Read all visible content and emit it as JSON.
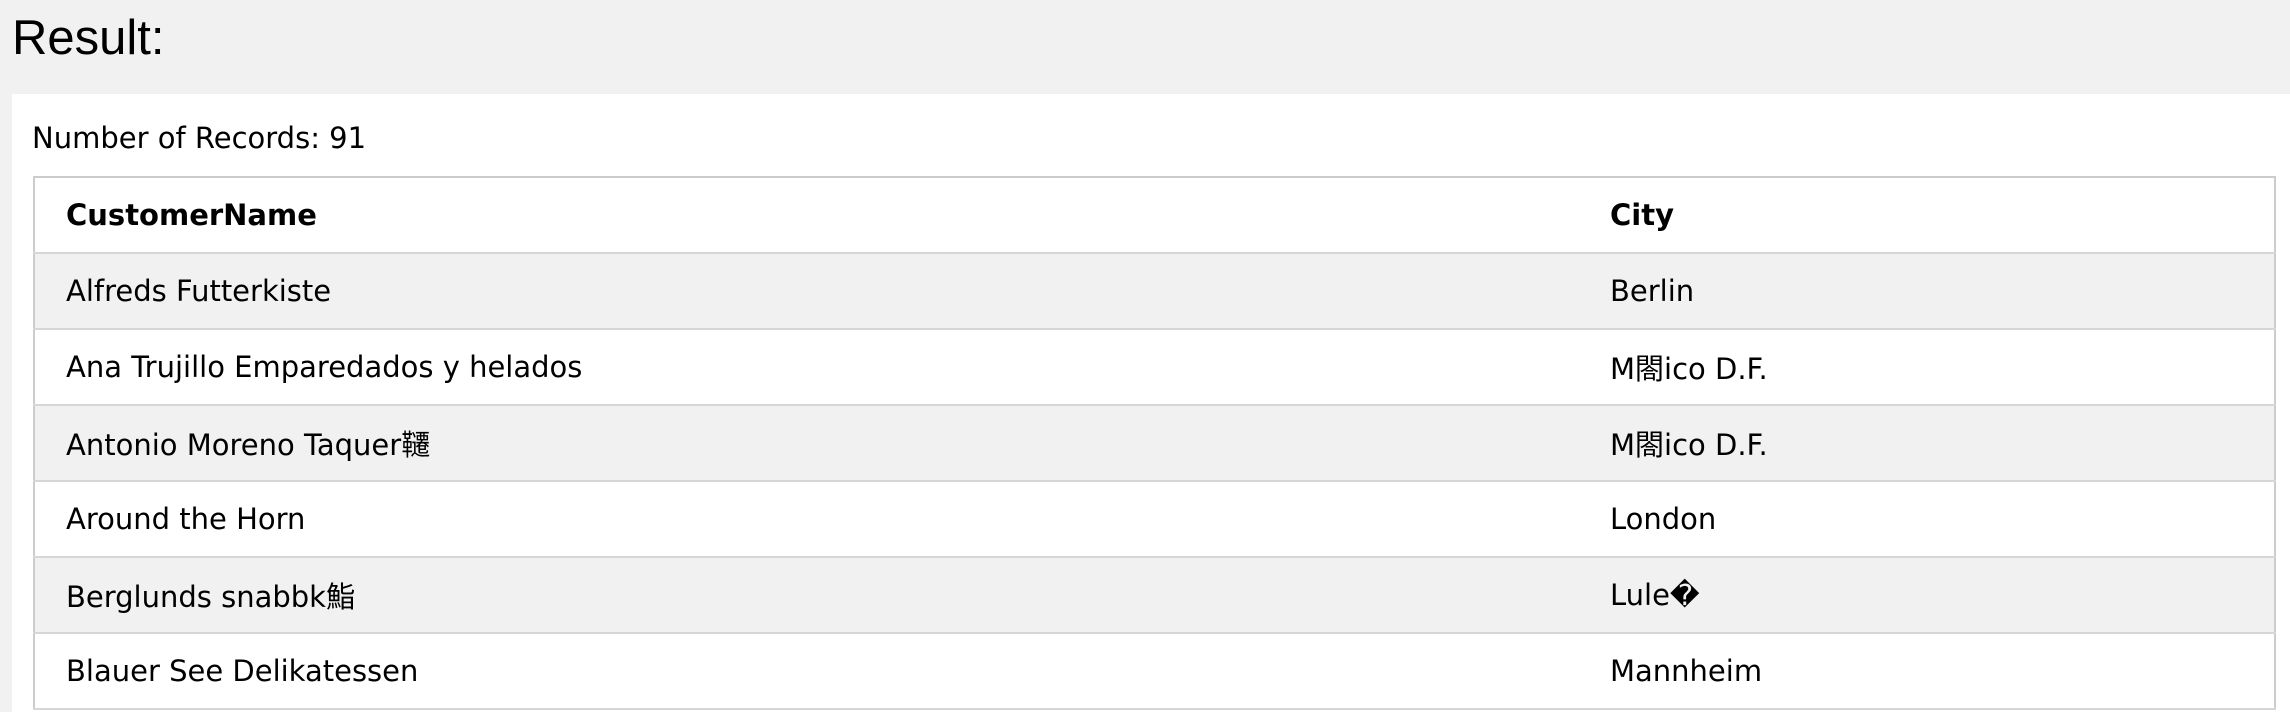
{
  "heading": "Result:",
  "record_count_text": "Number of Records: 91",
  "table": {
    "columns": [
      "CustomerName",
      "City"
    ],
    "rows": [
      [
        "Alfreds Futterkiste",
        "Berlin"
      ],
      [
        "Ana Trujillo Emparedados y helados",
        "M閤ico D.F."
      ],
      [
        "Antonio Moreno Taquer韆",
        "M閤ico D.F."
      ],
      [
        "Around the Horn",
        "London"
      ],
      [
        "Berglunds snabbk鮨",
        "Lule�"
      ],
      [
        "Blauer See Delikatessen",
        "Mannheim"
      ]
    ]
  }
}
